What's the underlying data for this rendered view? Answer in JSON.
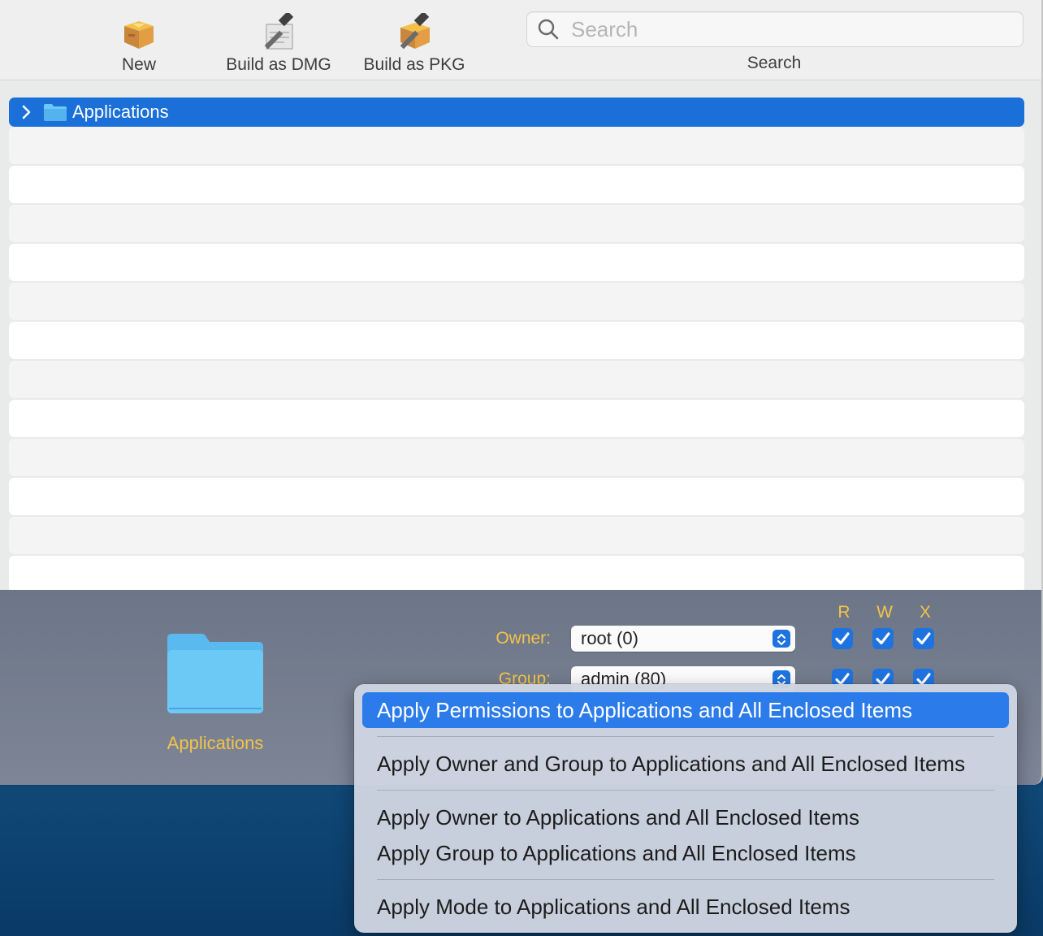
{
  "toolbar": {
    "new_label": "New",
    "build_dmg_label": "Build as DMG",
    "build_pkg_label": "Build as PKG",
    "search_placeholder": "Search",
    "search_label": "Search"
  },
  "outline": {
    "selected_item": "Applications"
  },
  "inspector": {
    "folder_name": "Applications",
    "headers": [
      "R",
      "W",
      "X"
    ],
    "owner_label": "Owner:",
    "owner_value": "root (0)",
    "group_label": "Group:",
    "group_value": "admin (80)"
  },
  "menu": {
    "items": [
      "Apply Permissions to Applications and All Enclosed Items",
      "Apply Owner and Group to Applications and All Enclosed Items",
      "Apply Owner to Applications and All Enclosed Items",
      "Apply Group to Applications and All Enclosed Items",
      "Apply Mode to Applications and All Enclosed Items"
    ]
  },
  "colors": {
    "selection": "#1a6fd8",
    "label_accent": "#f4c34a",
    "menu_highlight": "#2b7cea"
  }
}
